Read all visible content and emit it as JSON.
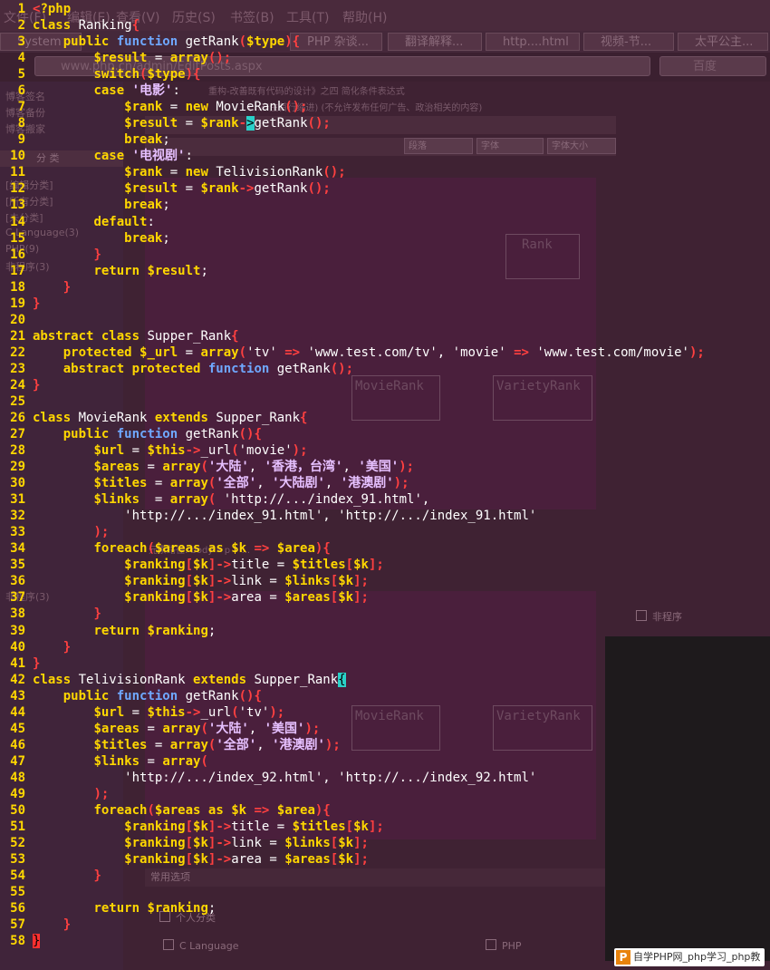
{
  "background": {
    "menu_items": [
      "文件(F)",
      "编辑(E)",
      "查看(V)",
      "历史(S)",
      "书签(B)",
      "工具(T)",
      "帮助(H)"
    ],
    "tabs": [
      "System",
      "PHP 杂谈...",
      "翻译解释...",
      "http....html",
      "视频-节...",
      "太平公主..."
    ],
    "url": "www.php.cn/admin/EditPosts.aspx",
    "search_placeholder": "百度",
    "page_heading": "重构-改善既有代码的设计》之四 简化条件表达式",
    "notice": "(...产生首行缩进) (不允许发布任何广告、政治相关的内容)",
    "sidebar_items": [
      "博客签名",
      "博客备份",
      "博客搬家"
    ],
    "sidebar_header": "分 类",
    "sidebar_cats": [
      "[编辑分类]",
      "[所有分类]",
      "[未分类]",
      "C Language(3)",
      "PHP(9)",
      "非程序(3)",
      "非程序(3)"
    ],
    "select_labels": [
      "段落",
      "字体",
      "字体大小"
    ],
    "section_label": "常用选项",
    "checkboxes": [
      "C Language",
      "PHP",
      "非程序",
      "个人分类"
    ],
    "breadcrumb": "元素路径: body » p » ..."
  },
  "uml": [
    "Rank",
    "MovieRank",
    "VarietyRank"
  ],
  "watermark": "自学PHP网_php学习_php教",
  "code_lines": [
    [
      [
        "op",
        "<"
      ],
      [
        "kw",
        "?php"
      ]
    ],
    [
      [
        "kw",
        "class "
      ],
      [
        "t",
        "Ranking"
      ],
      [
        "op",
        "{"
      ]
    ],
    [
      [
        "t",
        "    "
      ],
      [
        "kw",
        "public "
      ],
      [
        "fn",
        "function "
      ],
      [
        "t",
        "getRank"
      ],
      [
        "op",
        "("
      ],
      [
        "var",
        "$type"
      ],
      [
        "op",
        "){"
      ]
    ],
    [
      [
        "t",
        "        "
      ],
      [
        "var",
        "$result"
      ],
      [
        "t",
        " = "
      ],
      [
        "kw",
        "array"
      ],
      [
        "op",
        "();"
      ]
    ],
    [
      [
        "t",
        "        "
      ],
      [
        "kw",
        "switch"
      ],
      [
        "op",
        "("
      ],
      [
        "var",
        "$type"
      ],
      [
        "op",
        "){"
      ]
    ],
    [
      [
        "t",
        "        "
      ],
      [
        "kw",
        "case "
      ],
      [
        "cn",
        "'电影'"
      ],
      [
        "t",
        ":"
      ]
    ],
    [
      [
        "t",
        "            "
      ],
      [
        "var",
        "$rank"
      ],
      [
        "t",
        " = "
      ],
      [
        "kw",
        "new "
      ],
      [
        "t",
        "MovieRank"
      ],
      [
        "op",
        "();"
      ]
    ],
    [
      [
        "t",
        "            "
      ],
      [
        "var",
        "$result"
      ],
      [
        "t",
        " = "
      ],
      [
        "var",
        "$rank"
      ],
      [
        "op",
        "-"
      ],
      [
        "cur",
        ">"
      ],
      [
        "t",
        "getRank"
      ],
      [
        "op",
        "();"
      ]
    ],
    [
      [
        "t",
        "            "
      ],
      [
        "kw",
        "break"
      ],
      [
        "t",
        ";"
      ]
    ],
    [
      [
        "t",
        "        "
      ],
      [
        "kw",
        "case "
      ],
      [
        "cn",
        "'电视剧'"
      ],
      [
        "t",
        ":"
      ]
    ],
    [
      [
        "t",
        "            "
      ],
      [
        "var",
        "$rank"
      ],
      [
        "t",
        " = "
      ],
      [
        "kw",
        "new "
      ],
      [
        "t",
        "TelivisionRank"
      ],
      [
        "op",
        "();"
      ]
    ],
    [
      [
        "t",
        "            "
      ],
      [
        "var",
        "$result"
      ],
      [
        "t",
        " = "
      ],
      [
        "var",
        "$rank"
      ],
      [
        "op",
        "->"
      ],
      [
        "t",
        "getRank"
      ],
      [
        "op",
        "();"
      ]
    ],
    [
      [
        "t",
        "            "
      ],
      [
        "kw",
        "break"
      ],
      [
        "t",
        ";"
      ]
    ],
    [
      [
        "t",
        "        "
      ],
      [
        "kw",
        "default"
      ],
      [
        "t",
        ":"
      ]
    ],
    [
      [
        "t",
        "            "
      ],
      [
        "kw",
        "break"
      ],
      [
        "t",
        ";"
      ]
    ],
    [
      [
        "t",
        "        "
      ],
      [
        "op",
        "}"
      ]
    ],
    [
      [
        "t",
        "        "
      ],
      [
        "kw",
        "return "
      ],
      [
        "var",
        "$result"
      ],
      [
        "t",
        ";"
      ]
    ],
    [
      [
        "t",
        "    "
      ],
      [
        "op",
        "}"
      ]
    ],
    [
      [
        "op",
        "}"
      ]
    ],
    [],
    [
      [
        "kw",
        "abstract class "
      ],
      [
        "t",
        "Supper_Rank"
      ],
      [
        "op",
        "{"
      ]
    ],
    [
      [
        "t",
        "    "
      ],
      [
        "kw",
        "protected "
      ],
      [
        "var",
        "$_url"
      ],
      [
        "t",
        " = "
      ],
      [
        "kw",
        "array"
      ],
      [
        "op",
        "("
      ],
      [
        "t",
        "'tv' "
      ],
      [
        "op",
        "=>"
      ],
      [
        "t",
        " 'www.test.com/tv', 'movie' "
      ],
      [
        "op",
        "=>"
      ],
      [
        "t",
        " 'www.test.com/movie'"
      ],
      [
        "op",
        ");"
      ]
    ],
    [
      [
        "t",
        "    "
      ],
      [
        "kw",
        "abstract protected "
      ],
      [
        "fn",
        "function "
      ],
      [
        "t",
        "getRank"
      ],
      [
        "op",
        "();"
      ]
    ],
    [
      [
        "op",
        "}"
      ]
    ],
    [],
    [
      [
        "kw",
        "class "
      ],
      [
        "t",
        "MovieRank "
      ],
      [
        "kw",
        "extends "
      ],
      [
        "t",
        "Supper_Rank"
      ],
      [
        "op",
        "{"
      ]
    ],
    [
      [
        "t",
        "    "
      ],
      [
        "kw",
        "public "
      ],
      [
        "fn",
        "function "
      ],
      [
        "t",
        "getRank"
      ],
      [
        "op",
        "(){"
      ]
    ],
    [
      [
        "t",
        "        "
      ],
      [
        "var",
        "$url"
      ],
      [
        "t",
        " = "
      ],
      [
        "var",
        "$this"
      ],
      [
        "op",
        "->"
      ],
      [
        "t",
        "_url"
      ],
      [
        "op",
        "("
      ],
      [
        "t",
        "'movie'"
      ],
      [
        "op",
        ");"
      ]
    ],
    [
      [
        "t",
        "        "
      ],
      [
        "var",
        "$areas"
      ],
      [
        "t",
        " = "
      ],
      [
        "kw",
        "array"
      ],
      [
        "op",
        "("
      ],
      [
        "cn",
        "'大陆'"
      ],
      [
        "t",
        ", "
      ],
      [
        "cn",
        "'香港，台湾'"
      ],
      [
        "t",
        ", "
      ],
      [
        "cn",
        "'美国'"
      ],
      [
        "op",
        ");"
      ]
    ],
    [
      [
        "t",
        "        "
      ],
      [
        "var",
        "$titles"
      ],
      [
        "t",
        " = "
      ],
      [
        "kw",
        "array"
      ],
      [
        "op",
        "("
      ],
      [
        "cn",
        "'全部'"
      ],
      [
        "t",
        ", "
      ],
      [
        "cn",
        "'大陆剧'"
      ],
      [
        "t",
        ", "
      ],
      [
        "cn",
        "'港澳剧'"
      ],
      [
        "op",
        ");"
      ]
    ],
    [
      [
        "t",
        "        "
      ],
      [
        "var",
        "$links"
      ],
      [
        "t",
        "  = "
      ],
      [
        "kw",
        "array"
      ],
      [
        "op",
        "("
      ],
      [
        "t",
        " 'http://.../index_91.html',"
      ]
    ],
    [
      [
        "t",
        "            'http://.../index_91.html', 'http://.../index_91.html'"
      ]
    ],
    [
      [
        "t",
        "        "
      ],
      [
        "op",
        ");"
      ]
    ],
    [
      [
        "t",
        "        "
      ],
      [
        "kw",
        "foreach"
      ],
      [
        "op",
        "("
      ],
      [
        "var",
        "$areas"
      ],
      [
        "kw",
        " as "
      ],
      [
        "var",
        "$k"
      ],
      [
        "op",
        " => "
      ],
      [
        "var",
        "$area"
      ],
      [
        "op",
        "){"
      ]
    ],
    [
      [
        "t",
        "            "
      ],
      [
        "var",
        "$ranking"
      ],
      [
        "op",
        "["
      ],
      [
        "var",
        "$k"
      ],
      [
        "op",
        "]->"
      ],
      [
        "t",
        "title = "
      ],
      [
        "var",
        "$titles"
      ],
      [
        "op",
        "["
      ],
      [
        "var",
        "$k"
      ],
      [
        "op",
        "];"
      ]
    ],
    [
      [
        "t",
        "            "
      ],
      [
        "var",
        "$ranking"
      ],
      [
        "op",
        "["
      ],
      [
        "var",
        "$k"
      ],
      [
        "op",
        "]->"
      ],
      [
        "t",
        "link = "
      ],
      [
        "var",
        "$links"
      ],
      [
        "op",
        "["
      ],
      [
        "var",
        "$k"
      ],
      [
        "op",
        "];"
      ]
    ],
    [
      [
        "t",
        "            "
      ],
      [
        "var",
        "$ranking"
      ],
      [
        "op",
        "["
      ],
      [
        "var",
        "$k"
      ],
      [
        "op",
        "]->"
      ],
      [
        "t",
        "area = "
      ],
      [
        "var",
        "$areas"
      ],
      [
        "op",
        "["
      ],
      [
        "var",
        "$k"
      ],
      [
        "op",
        "];"
      ]
    ],
    [
      [
        "t",
        "        "
      ],
      [
        "op",
        "}"
      ]
    ],
    [
      [
        "t",
        "        "
      ],
      [
        "kw",
        "return "
      ],
      [
        "var",
        "$ranking"
      ],
      [
        "t",
        ";"
      ]
    ],
    [
      [
        "t",
        "    "
      ],
      [
        "op",
        "}"
      ]
    ],
    [
      [
        "op",
        "}"
      ]
    ],
    [
      [
        "kw",
        "class "
      ],
      [
        "t",
        "TelivisionRank "
      ],
      [
        "kw",
        "extends "
      ],
      [
        "t",
        "Supper_Rank"
      ],
      [
        "cur",
        "{"
      ]
    ],
    [
      [
        "t",
        "    "
      ],
      [
        "kw",
        "public "
      ],
      [
        "fn",
        "function "
      ],
      [
        "t",
        "getRank"
      ],
      [
        "op",
        "(){"
      ]
    ],
    [
      [
        "t",
        "        "
      ],
      [
        "var",
        "$url"
      ],
      [
        "t",
        " = "
      ],
      [
        "var",
        "$this"
      ],
      [
        "op",
        "->"
      ],
      [
        "t",
        "_url"
      ],
      [
        "op",
        "("
      ],
      [
        "t",
        "'tv'"
      ],
      [
        "op",
        ");"
      ]
    ],
    [
      [
        "t",
        "        "
      ],
      [
        "var",
        "$areas"
      ],
      [
        "t",
        " = "
      ],
      [
        "kw",
        "array"
      ],
      [
        "op",
        "("
      ],
      [
        "cn",
        "'大陆'"
      ],
      [
        "t",
        ", "
      ],
      [
        "cn",
        "'美国'"
      ],
      [
        "op",
        ");"
      ]
    ],
    [
      [
        "t",
        "        "
      ],
      [
        "var",
        "$titles"
      ],
      [
        "t",
        " = "
      ],
      [
        "kw",
        "array"
      ],
      [
        "op",
        "("
      ],
      [
        "cn",
        "'全部'"
      ],
      [
        "t",
        ", "
      ],
      [
        "cn",
        "'港澳剧'"
      ],
      [
        "op",
        ");"
      ]
    ],
    [
      [
        "t",
        "        "
      ],
      [
        "var",
        "$links"
      ],
      [
        "t",
        " = "
      ],
      [
        "kw",
        "array"
      ],
      [
        "op",
        "("
      ]
    ],
    [
      [
        "t",
        "            'http://.../index_92.html', 'http://.../index_92.html'"
      ]
    ],
    [
      [
        "t",
        "        "
      ],
      [
        "op",
        ");"
      ]
    ],
    [
      [
        "t",
        "        "
      ],
      [
        "kw",
        "foreach"
      ],
      [
        "op",
        "("
      ],
      [
        "var",
        "$areas"
      ],
      [
        "kw",
        " as "
      ],
      [
        "var",
        "$k"
      ],
      [
        "op",
        " => "
      ],
      [
        "var",
        "$area"
      ],
      [
        "op",
        "){"
      ]
    ],
    [
      [
        "t",
        "            "
      ],
      [
        "var",
        "$ranking"
      ],
      [
        "op",
        "["
      ],
      [
        "var",
        "$k"
      ],
      [
        "op",
        "]->"
      ],
      [
        "t",
        "title = "
      ],
      [
        "var",
        "$titles"
      ],
      [
        "op",
        "["
      ],
      [
        "var",
        "$k"
      ],
      [
        "op",
        "];"
      ]
    ],
    [
      [
        "t",
        "            "
      ],
      [
        "var",
        "$ranking"
      ],
      [
        "op",
        "["
      ],
      [
        "var",
        "$k"
      ],
      [
        "op",
        "]->"
      ],
      [
        "t",
        "link = "
      ],
      [
        "var",
        "$links"
      ],
      [
        "op",
        "["
      ],
      [
        "var",
        "$k"
      ],
      [
        "op",
        "];"
      ]
    ],
    [
      [
        "t",
        "            "
      ],
      [
        "var",
        "$ranking"
      ],
      [
        "op",
        "["
      ],
      [
        "var",
        "$k"
      ],
      [
        "op",
        "]->"
      ],
      [
        "t",
        "area = "
      ],
      [
        "var",
        "$areas"
      ],
      [
        "op",
        "["
      ],
      [
        "var",
        "$k"
      ],
      [
        "op",
        "];"
      ]
    ],
    [
      [
        "t",
        "        "
      ],
      [
        "op",
        "}"
      ]
    ],
    [],
    [
      [
        "t",
        "        "
      ],
      [
        "kw",
        "return "
      ],
      [
        "var",
        "$ranking"
      ],
      [
        "t",
        ";"
      ]
    ],
    [
      [
        "t",
        "    "
      ],
      [
        "op",
        "}"
      ]
    ],
    [
      [
        "red",
        "}"
      ]
    ]
  ],
  "colors": {
    "background": "#3b2030",
    "line_number": "#ffd700",
    "keyword": "#ffd700",
    "function_keyword": "#6fa8ff",
    "operator": "#ff4040",
    "chinese_string": "#e6c0ff",
    "cursor": "#2ad0c8"
  }
}
